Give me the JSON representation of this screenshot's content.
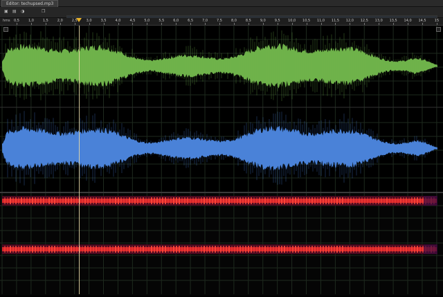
{
  "tab": {
    "title": "Editor: techupsed.mp3"
  },
  "toolbar": {
    "b1": "▣",
    "b2": "▤",
    "b3": "◑",
    "b4": "❐"
  },
  "ruler": {
    "unit": "hms",
    "ticks": [
      "0,5",
      "1,0",
      "1,5",
      "2,0",
      "2,5",
      "3,0",
      "3,5",
      "4,0",
      "4,5",
      "5,0",
      "5,5",
      "6,0",
      "6,5",
      "7,0",
      "7,5",
      "8,0",
      "8,5",
      "9,0",
      "9,5",
      "10,0",
      "10,5",
      "11,0",
      "11,5",
      "12,0",
      "12,5",
      "13,0",
      "13,5",
      "14,0",
      "14,5",
      "15"
    ]
  },
  "colors": {
    "wave_left": "#6fb24a",
    "wave_right": "#4a82d8",
    "spectral": "#d8262a",
    "playhead": "#e8b22a"
  }
}
